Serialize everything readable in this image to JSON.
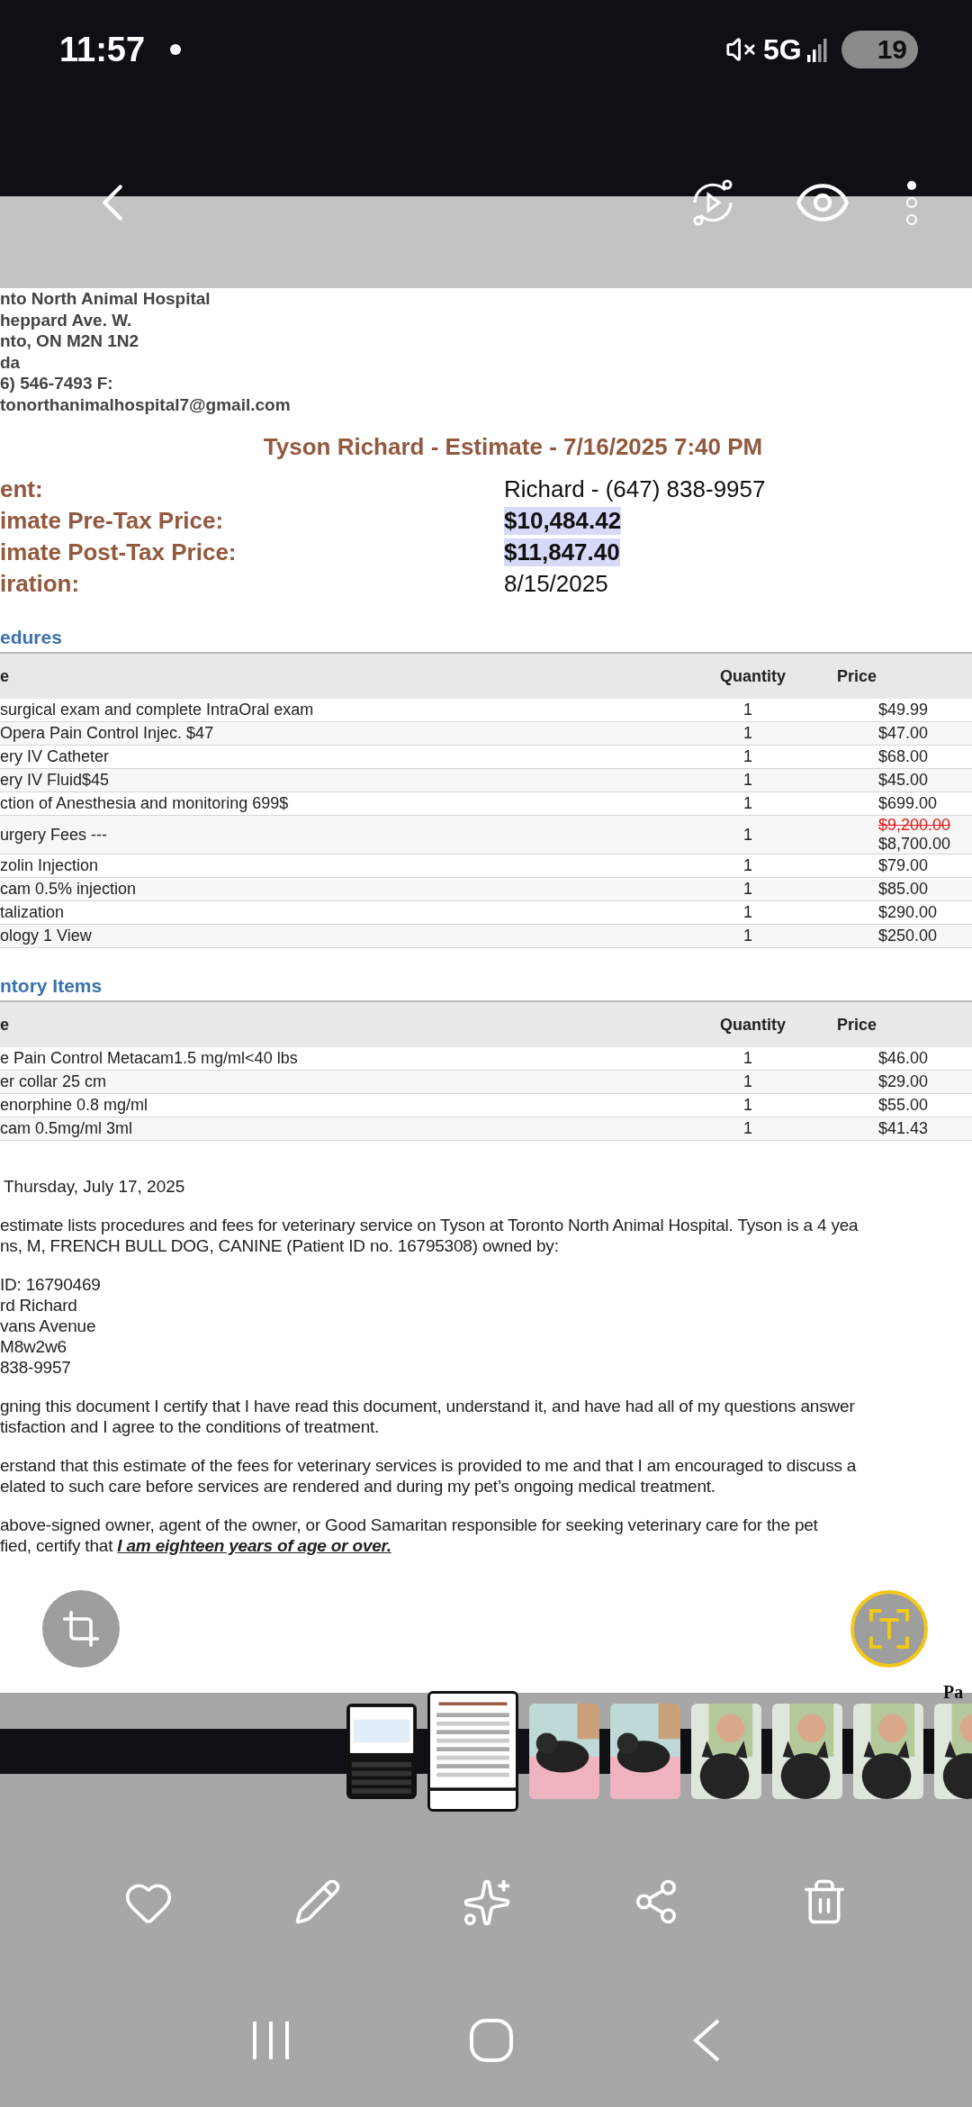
{
  "status_bar": {
    "time": "11:57",
    "network": "5G",
    "battery": "19"
  },
  "document": {
    "clinic_lines": [
      "nto North Animal Hospital",
      "heppard Ave. W.",
      "nto, ON M2N 1N2",
      "da",
      "6) 546-7493    F:",
      "tonorthanimalhospital7@gmail.com"
    ],
    "title": "Tyson Richard - Estimate - 7/16/2025 7:40 PM",
    "summary": [
      {
        "label": "ent:",
        "value": "Richard - (647) 838-9957",
        "highlighted": false
      },
      {
        "label": "imate Pre-Tax Price:",
        "value": "$10,484.42",
        "highlighted": true
      },
      {
        "label": "imate Post-Tax Price:",
        "value": "$11,847.40",
        "highlighted": true
      },
      {
        "label": "iration:",
        "value": "8/15/2025",
        "highlighted": false
      }
    ],
    "sections": [
      {
        "heading": "edures",
        "columns": [
          "e",
          "Quantity",
          "Price"
        ],
        "rows": [
          {
            "description": "surgical exam and complete IntraOral exam",
            "quantity": "1",
            "price": "$49.99"
          },
          {
            "description": "Opera Pain Control Injec. $47",
            "quantity": "1",
            "price": "$47.00"
          },
          {
            "description": "ery IV Catheter",
            "quantity": "1",
            "price": "$68.00"
          },
          {
            "description": "ery IV Fluid$45",
            "quantity": "1",
            "price": "$45.00"
          },
          {
            "description": "ction of Anesthesia and monitoring 699$",
            "quantity": "1",
            "price": "$699.00"
          },
          {
            "description": "urgery Fees ---",
            "quantity": "1",
            "old_price": "$9,200.00",
            "price": "$8,700.00"
          },
          {
            "description": "zolin Injection",
            "quantity": "1",
            "price": "$79.00"
          },
          {
            "description": "cam 0.5% injection",
            "quantity": "1",
            "price": "$85.00"
          },
          {
            "description": "talization",
            "quantity": "1",
            "price": "$290.00"
          },
          {
            "description": "ology 1 View",
            "quantity": "1",
            "price": "$250.00"
          }
        ]
      },
      {
        "heading": "ntory Items",
        "columns": [
          "e",
          "Quantity",
          "Price"
        ],
        "rows": [
          {
            "description": "e Pain Control Metacam1.5 mg/ml<40 lbs",
            "quantity": "1",
            "price": "$46.00"
          },
          {
            "description": "er collar 25 cm",
            "quantity": "1",
            "price": "$29.00"
          },
          {
            "description": "enorphine 0.8 mg/ml",
            "quantity": "1",
            "price": "$55.00"
          },
          {
            "description": "cam 0.5mg/ml 3ml",
            "quantity": "1",
            "price": "$41.43"
          }
        ]
      }
    ],
    "date": "Thursday, July 17, 2025",
    "paragraphs": [
      [
        "estimate lists procedures and fees for veterinary service on Tyson at Toronto North Animal Hospital. Tyson is a 4 yea",
        "ns, M, FRENCH BULL DOG, CANINE (Patient ID no. 16795308) owned by:"
      ],
      [
        "ID: 16790469",
        "rd Richard",
        "vans Avenue",
        "M8w2w6",
        "838-9957"
      ],
      [
        "gning this document I certify that I have read this document, understand it, and have had all of my questions answer",
        "tisfaction and I agree to the conditions of treatment."
      ],
      [
        "erstand that this estimate of the fees for veterinary services is provided to me and that I am encouraged to discuss a",
        "elated to such care before services are rendered and during my pet’s ongoing medical treatment."
      ],
      [
        "above-signed owner, agent of the owner, or Good Samaritan responsible for seeking veterinary care for the pet",
        "fied, certify that **I am eighteen years of age or over.**"
      ]
    ],
    "next_page_text": "Pa"
  },
  "thumbnails": [
    {
      "kind": "picture",
      "selected": false
    },
    {
      "kind": "picture",
      "selected": true
    },
    {
      "kind": "picture",
      "selected": false
    },
    {
      "kind": "picture",
      "selected": false
    },
    {
      "kind": "picture",
      "selected": false
    },
    {
      "kind": "picture",
      "selected": false
    },
    {
      "kind": "picture",
      "selected": false
    },
    {
      "kind": "picture",
      "selected": false
    }
  ]
}
